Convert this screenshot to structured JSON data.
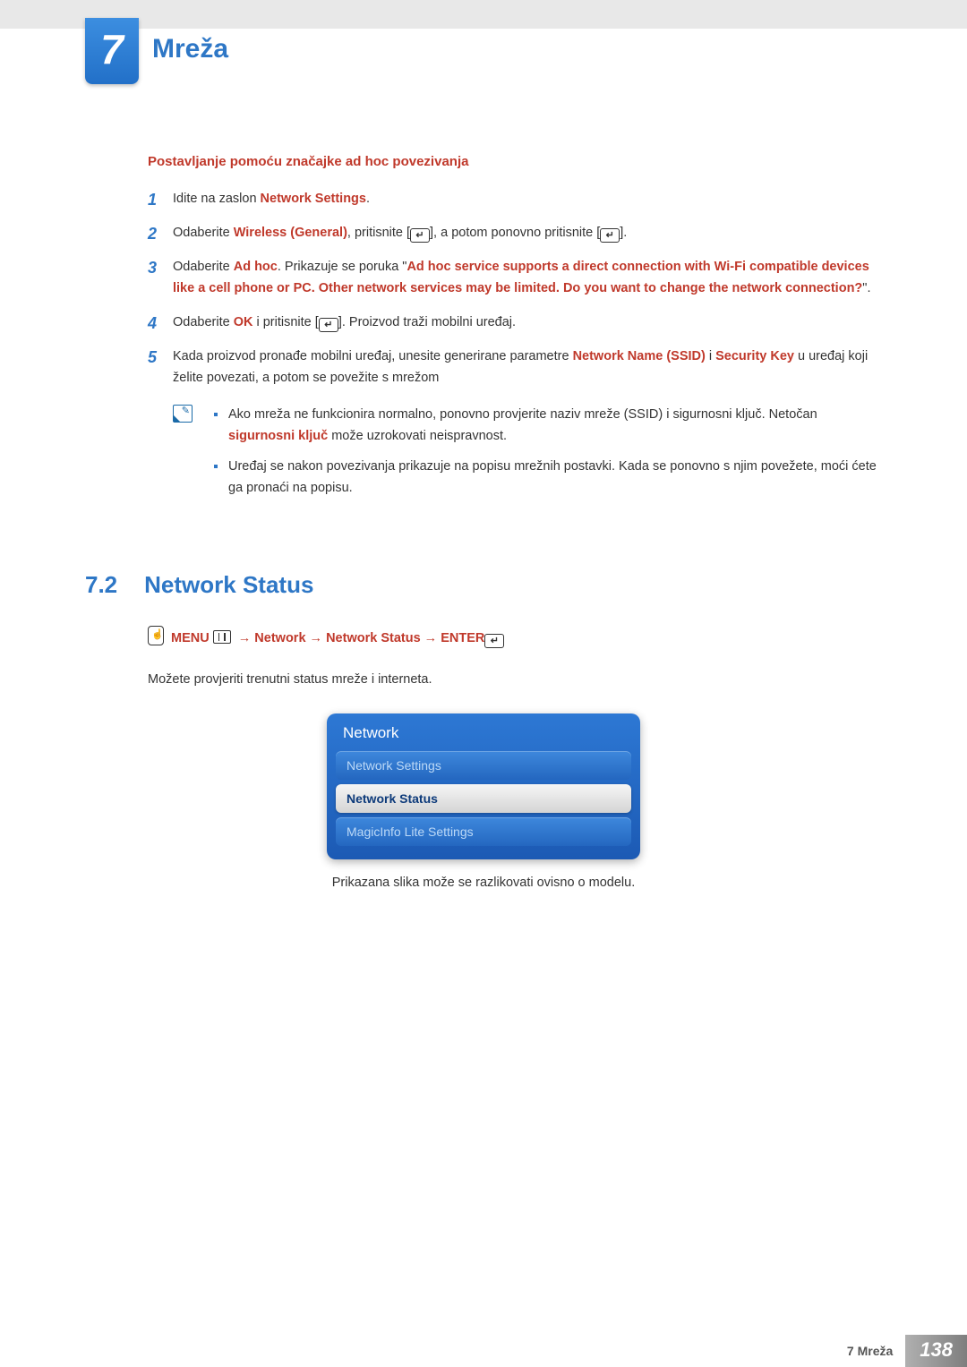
{
  "chapter": {
    "number": "7",
    "title": "Mreža"
  },
  "subsection_title": "Postavljanje pomoću značajke ad hoc povezivanja",
  "steps": {
    "s1": {
      "n": "1",
      "t1": "Idite na zaslon ",
      "hl1": "Network Settings",
      "t2": "."
    },
    "s2": {
      "n": "2",
      "t1": "Odaberite ",
      "hl1": "Wireless (General)",
      "t2": ", pritisnite [",
      "t3": "], a potom ponovno pritisnite [",
      "t4": "]."
    },
    "s3": {
      "n": "3",
      "t1": "Odaberite ",
      "hl1": "Ad hoc",
      "t2": ". Prikazuje se poruka \"",
      "hl2": "Ad hoc service supports a direct connection with Wi-Fi compatible devices like a cell phone or PC. Other network services may be limited. Do you want to change the network connection?",
      "t3": "\"."
    },
    "s4": {
      "n": "4",
      "t1": "Odaberite ",
      "hl1": "OK",
      "t2": " i pritisnite [",
      "t3": "]. Proizvod traži mobilni uređaj."
    },
    "s5": {
      "n": "5",
      "t1": "Kada proizvod pronađe mobilni uređaj, unesite generirane parametre ",
      "hl1": "Network Name (SSID)",
      "t2": " i ",
      "hl2": "Security Key",
      "t3": " u uređaj koji želite povezati, a potom se povežite s mrežom"
    }
  },
  "notes": {
    "b1": {
      "t1": "Ako mreža ne funkcionira normalno, ponovno provjerite naziv mreže (SSID) i sigurnosni ključ. Netočan ",
      "hl": "sigurnosni ključ",
      "t2": " može uzrokovati neispravnost."
    },
    "b2": "Uređaj se nakon povezivanja prikazuje na popisu mrežnih postavki. Kada se ponovno s njim povežete, moći ćete ga pronaći na popisu."
  },
  "section": {
    "num": "7.2",
    "title": "Network Status"
  },
  "nav": {
    "menu": "MENU",
    "n1": "Network",
    "n2": "Network Status",
    "enter": "ENTER"
  },
  "desc": "Možete provjeriti trenutni status mreže i interneta.",
  "osd": {
    "title": "Network",
    "i1": "Network Settings",
    "i2": "Network Status",
    "i3": "MagicInfo Lite Settings"
  },
  "caption": "Prikazana slika može se razlikovati ovisno o modelu.",
  "footer": {
    "label": "7 Mreža",
    "page": "138"
  }
}
